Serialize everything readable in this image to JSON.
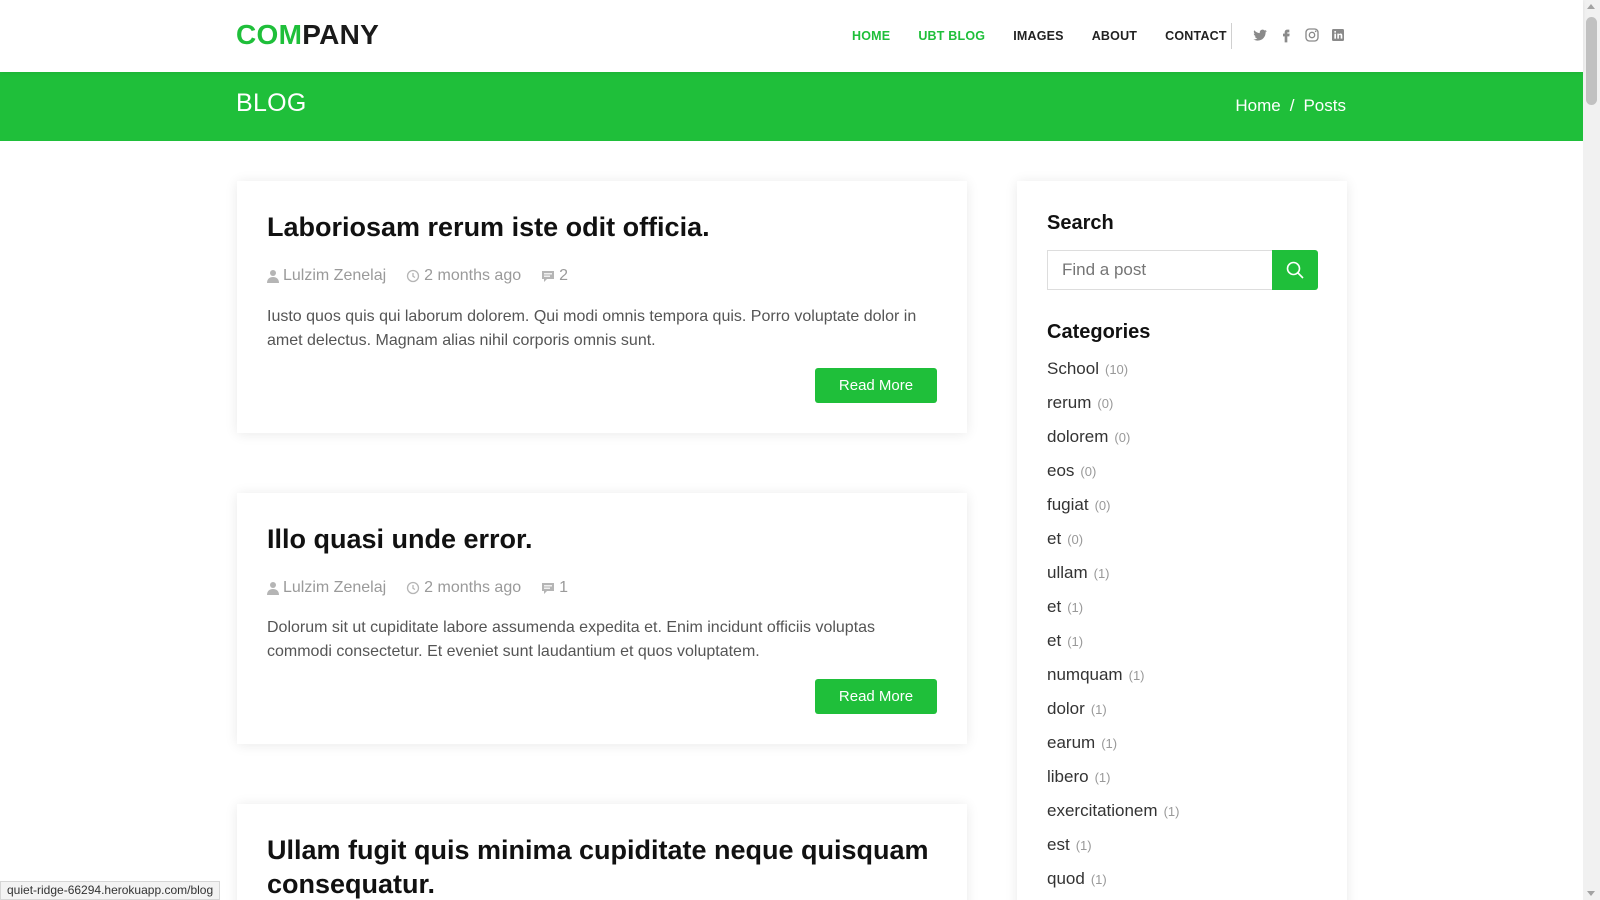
{
  "header": {
    "logo_part1": "COM",
    "logo_part2": "PANY",
    "nav": [
      {
        "label": "HOME",
        "active": true
      },
      {
        "label": "UBT BLOG",
        "active": true
      },
      {
        "label": "IMAGES",
        "active": false
      },
      {
        "label": "ABOUT",
        "active": false
      },
      {
        "label": "CONTACT",
        "active": false
      }
    ],
    "social_icons": [
      "twitter-icon",
      "facebook-icon",
      "instagram-icon",
      "linkedin-icon"
    ]
  },
  "banner": {
    "title": "BLOG",
    "breadcrumb": {
      "home": "Home",
      "separator": "/",
      "current": "Posts"
    }
  },
  "posts": [
    {
      "title": "Laboriosam rerum iste odit officia.",
      "author": "Lulzim Zenelaj",
      "date": "2 months ago",
      "comments": "2",
      "excerpt": "Iusto quos quis qui laborum dolorem. Qui modi omnis tempora quis. Porro voluptate dolor in amet delectus. Magnam alias nihil corporis omnis sunt.",
      "button": "Read More"
    },
    {
      "title": "Illo quasi unde error.",
      "author": "Lulzim Zenelaj",
      "date": "2 months ago",
      "comments": "1",
      "excerpt": "Dolorum sit ut cupiditate labore assumenda expedita et. Enim incidunt officiis voluptas commodi consectetur. Et eveniet sunt laudantium et quos voluptatem.",
      "button": "Read More"
    },
    {
      "title": "Ullam fugit quis minima cupiditate neque quisquam consequatur."
    }
  ],
  "sidebar": {
    "search_heading": "Search",
    "search_placeholder": "Find a post",
    "categories_heading": "Categories",
    "categories": [
      {
        "name": "School",
        "count": "(10)"
      },
      {
        "name": "rerum",
        "count": "(0)"
      },
      {
        "name": "dolorem",
        "count": "(0)"
      },
      {
        "name": "eos",
        "count": "(0)"
      },
      {
        "name": "fugiat",
        "count": "(0)"
      },
      {
        "name": "et",
        "count": "(0)"
      },
      {
        "name": "ullam",
        "count": "(1)"
      },
      {
        "name": "et",
        "count": "(1)"
      },
      {
        "name": "et",
        "count": "(1)"
      },
      {
        "name": "numquam",
        "count": "(1)"
      },
      {
        "name": "dolor",
        "count": "(1)"
      },
      {
        "name": "earum",
        "count": "(1)"
      },
      {
        "name": "libero",
        "count": "(1)"
      },
      {
        "name": "exercitationem",
        "count": "(1)"
      },
      {
        "name": "est",
        "count": "(1)"
      },
      {
        "name": "quod",
        "count": "(1)"
      }
    ]
  },
  "statusbar": {
    "url": "quiet-ridge-66294.herokuapp.com/blog"
  },
  "colors": {
    "accent": "#1fbf3a",
    "text": "#111111",
    "muted": "#9a9a9a"
  }
}
